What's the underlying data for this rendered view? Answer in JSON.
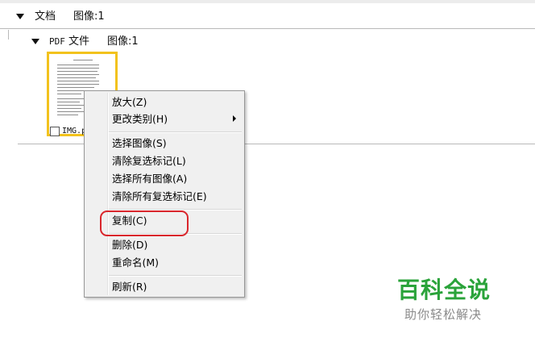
{
  "top_group": {
    "label": "文档",
    "count": "图像:1"
  },
  "sub_group": {
    "label_prefix": "PDF",
    "label_suffix": "文件",
    "count": "图像:1"
  },
  "thumbnail": {
    "caption": "IMG.p"
  },
  "context_menu": {
    "items": [
      {
        "label": "放大(Z)"
      },
      {
        "label": "更改类别(H)",
        "has_submenu": true
      },
      {
        "label": "选择图像(S)"
      },
      {
        "label": "清除复选标记(L)"
      },
      {
        "label": "选择所有图像(A)"
      },
      {
        "label": "清除所有复选标记(E)"
      },
      {
        "label": "复制(C)",
        "highlighted": true
      },
      {
        "label": "删除(D)"
      },
      {
        "label": "重命名(M)"
      },
      {
        "label": "刷新(R)"
      }
    ]
  },
  "watermark": {
    "title": "百科全说",
    "subtitle": "助你轻松解决"
  },
  "colors": {
    "thumbnail_border": "#f2c21d",
    "highlight_ring": "#d9262c",
    "watermark_green": "#2aa33a"
  }
}
